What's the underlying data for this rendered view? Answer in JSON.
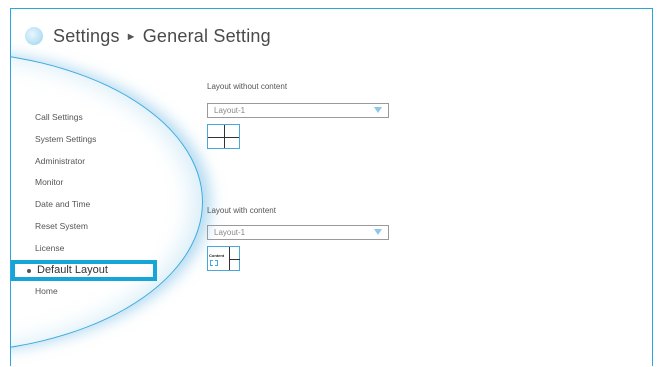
{
  "header": {
    "title_part1": "Settings",
    "separator": "►",
    "title_part2": "General Setting"
  },
  "sidebar": {
    "items": [
      {
        "label": "Call Settings"
      },
      {
        "label": "System Settings"
      },
      {
        "label": "Administrator"
      },
      {
        "label": "Monitor"
      },
      {
        "label": "Date and Time"
      },
      {
        "label": "Reset System"
      },
      {
        "label": "License"
      },
      {
        "label": "Default Layout",
        "active": true
      },
      {
        "label": "Home"
      }
    ]
  },
  "main": {
    "without_content": {
      "label": "Layout without content",
      "selected": "Layout-1"
    },
    "with_content": {
      "label": "Layout with content",
      "selected": "Layout-1",
      "preview_tag": "Content"
    }
  },
  "colors": {
    "accent": "#17a5d8",
    "frame": "#2ba7dd",
    "text": "#555555"
  },
  "icons": {
    "header": "gear-icon",
    "dropdown": "chevron-down-icon"
  }
}
